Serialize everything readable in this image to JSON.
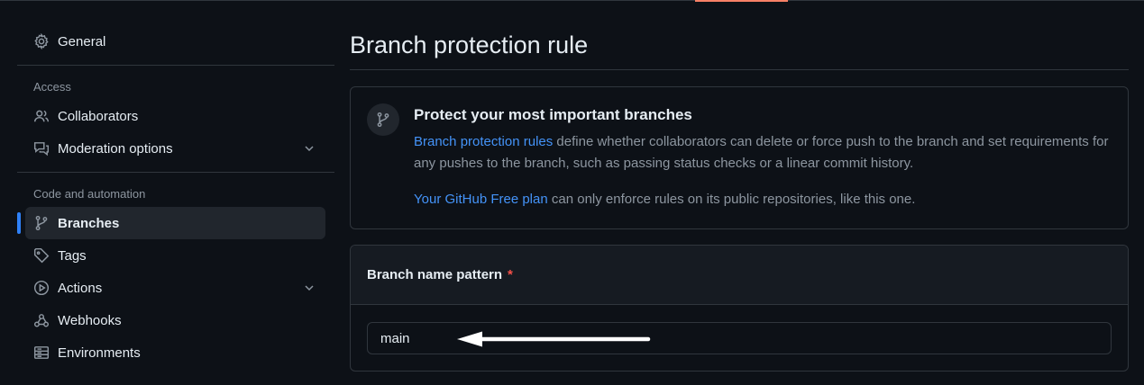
{
  "sidebar": {
    "general_label": "General",
    "access_heading": "Access",
    "collaborators_label": "Collaborators",
    "moderation_label": "Moderation options",
    "code_heading": "Code and automation",
    "branches_label": "Branches",
    "tags_label": "Tags",
    "actions_label": "Actions",
    "webhooks_label": "Webhooks",
    "environments_label": "Environments"
  },
  "main": {
    "title": "Branch protection rule",
    "info": {
      "title": "Protect your most important branches",
      "rules_link": "Branch protection rules",
      "rules_text": " define whether collaborators can delete or force push to the branch and set requirements for any pushes to the branch, such as passing status checks or a linear commit history.",
      "plan_link": "Your GitHub Free plan",
      "plan_text": " can only enforce rules on its public repositories, like this one."
    },
    "pattern": {
      "label": "Branch name pattern",
      "required_mark": "*",
      "value": "main"
    }
  },
  "colors": {
    "background": "#0d1117",
    "border": "#30363d",
    "accent_blue": "#2f81f7",
    "link": "#4493f8",
    "muted": "#8d96a0",
    "required": "#f85149",
    "top_accent": "#f78166"
  },
  "icons": {
    "general": "gear-icon",
    "collaborators": "people-icon",
    "moderation": "comment-discussion-icon",
    "branches": "git-branch-icon",
    "tags": "tag-icon",
    "actions": "play-icon",
    "webhooks": "webhook-icon",
    "environments": "server-icon",
    "expand": "chevron-down-icon"
  }
}
